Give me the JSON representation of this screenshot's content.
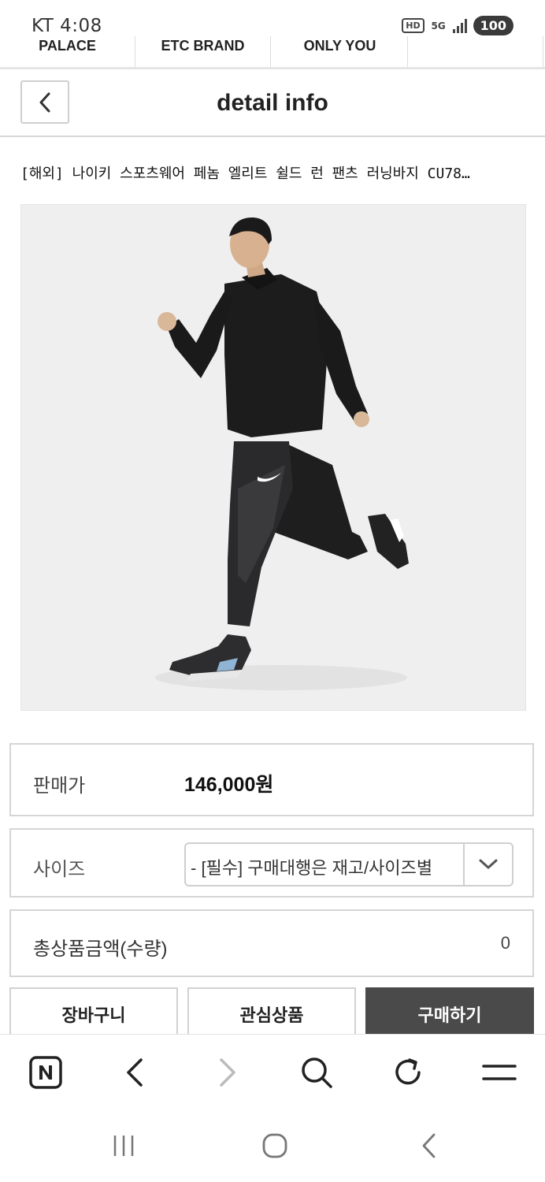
{
  "status_bar": {
    "carrier_time": "KT 4:08",
    "hd_label": "HD",
    "network_label": "5G",
    "battery": "100"
  },
  "brand_strip": {
    "items": [
      "PALACE",
      "ETC BRAND",
      "ONLY YOU",
      ""
    ]
  },
  "header": {
    "title": "detail info",
    "back_icon": "chevron-left-icon"
  },
  "product": {
    "title": "[해외] 나이키 스포츠웨어 페놈 엘리트 쉴드 런 팬츠 러닝바지 CU78…",
    "image_description_icon": "product-photo"
  },
  "price": {
    "label": "판매가",
    "value": "146,000원"
  },
  "size": {
    "label": "사이즈",
    "selected": "- [필수] 구매대행은 재고/사이즈별",
    "arrow_icon": "chevron-down-icon"
  },
  "total": {
    "label": "총상품금액(수량)",
    "quantity": "0"
  },
  "actions": {
    "cart": "장바구니",
    "wishlist": "관심상품",
    "buy": "구매하기"
  },
  "browser_toolbar": {
    "icons": [
      "naver-home-icon",
      "back-icon",
      "forward-icon",
      "search-icon",
      "refresh-icon",
      "menu-icon"
    ]
  },
  "system_nav": {
    "icons": [
      "recent-apps-icon",
      "home-icon",
      "system-back-icon"
    ]
  },
  "colors": {
    "buy_button": "#4a4a4a",
    "border": "#d5d5d5",
    "image_bg": "#efefef"
  }
}
